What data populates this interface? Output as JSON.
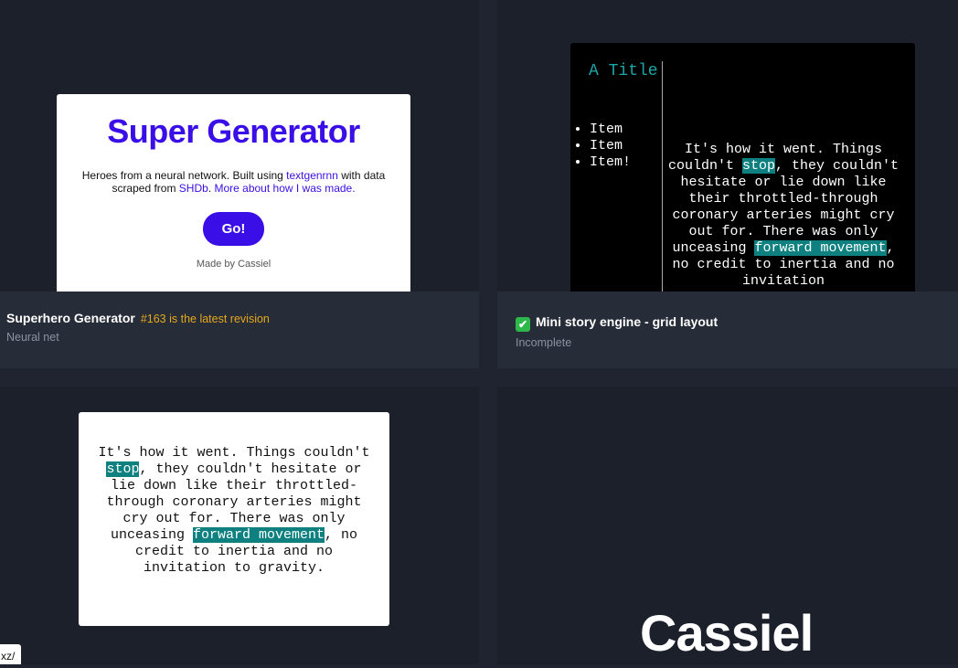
{
  "card1": {
    "preview": {
      "title": "Super Generator",
      "desc_text1": "Heroes from a neural network. Built using ",
      "desc_link1": "textgenrnn",
      "desc_text2": " with data scraped from ",
      "desc_link2": "SHDb",
      "desc_text3": ". ",
      "desc_link3": "More about how I was made.",
      "go_label": "Go!",
      "made_by": "Made by Cassiel"
    },
    "title": "Superhero Generator",
    "revision": "#163 is the latest revision",
    "subtitle": "Neural net"
  },
  "card2": {
    "preview": {
      "a_title": "A Title",
      "items": [
        "Item",
        "Item",
        "Item!"
      ],
      "p1": "It's how it went. Things couldn't ",
      "h1": "stop",
      "p2": ", they couldn't hesitate or lie down like their throttled-through coronary arteries might cry out for. There was only unceasing ",
      "h2": "forward movement",
      "p3": ", no credit to inertia and no invitation"
    },
    "check_icon": "✔",
    "title": "Mini story engine - grid layout",
    "subtitle": "Incomplete"
  },
  "card3": {
    "preview": {
      "p1": "It's how it went. Things couldn't ",
      "h1": "stop",
      "p2": ", they couldn't hesitate or lie down like their throttled-through coronary arteries might cry out for. There was only unceasing ",
      "h2": "forward movement",
      "p3": ", no credit to inertia and no invitation to gravity."
    }
  },
  "card4": {
    "text": "Cassiel"
  },
  "status_url": "xz/",
  "colors": {
    "background": "#1f2430",
    "accent": "#3a0ee6",
    "highlight": "#0e8080",
    "revision": "#e5a91d"
  }
}
